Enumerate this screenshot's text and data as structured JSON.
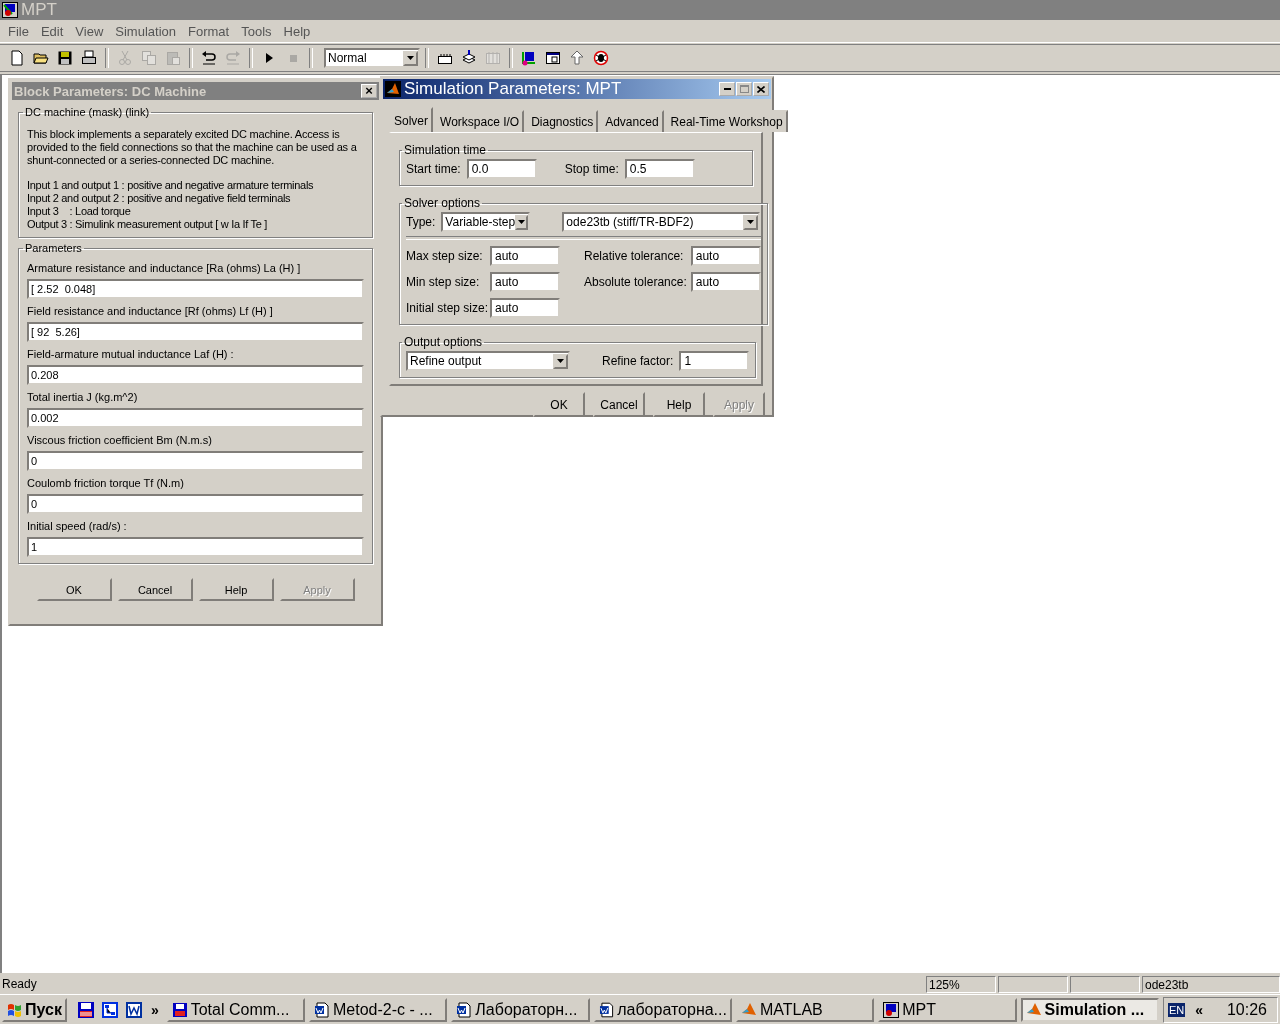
{
  "window": {
    "title": "MPT",
    "active": false
  },
  "menu": [
    "File",
    "Edit",
    "View",
    "Simulation",
    "Format",
    "Tools",
    "Help"
  ],
  "toolbar": {
    "buttons": [
      {
        "disabled": false
      },
      {
        "disabled": false
      },
      {
        "disabled": false
      },
      {
        "disabled": false
      },
      {
        "disabled": true
      },
      {
        "disabled": true
      },
      {
        "disabled": true
      },
      {
        "disabled": false
      },
      {
        "disabled": true
      },
      {
        "disabled": false
      },
      {
        "disabled": true
      },
      {
        "disabled": false
      },
      {
        "disabled": false
      },
      {
        "disabled": true
      },
      {
        "disabled": false
      },
      {
        "disabled": false
      },
      {
        "disabled": false
      },
      {
        "disabled": false
      }
    ],
    "mode": "Normal"
  },
  "block_dialog": {
    "title": "Block Parameters: DC Machine",
    "active": false,
    "close": "×",
    "description": {
      "legend": "DC machine (mask) (link)",
      "text": "This block implements a separately excited DC machine. Access is provided  to the field connections so that the machine can be used as a shunt-connected or a series-connected  DC machine.",
      "lines": [
        "Input 1 and output 1 : positive and negative armature terminals",
        "Input 2 and output 2 : positive and negative field terminals",
        "Input 3    : Load torque",
        "Output 3 : Simulink measurement output [ w Ia If Te ]"
      ]
    },
    "parameters": {
      "legend": "Parameters",
      "fields": [
        {
          "label": "Armature resistance and inductance [Ra (ohms) La (H) ]",
          "value": "[ 2.52  0.048]"
        },
        {
          "label": "Field resistance and inductance [Rf (ohms) Lf (H) ]",
          "value": "[ 92  5.26]"
        },
        {
          "label": "Field-armature mutual inductance Laf (H) :",
          "value": "0.208"
        },
        {
          "label": "Total inertia J (kg.m^2)",
          "value": "0.002"
        },
        {
          "label": "Viscous friction coefficient Bm (N.m.s)",
          "value": "0"
        },
        {
          "label": "Coulomb friction torque Tf (N.m)",
          "value": "0"
        },
        {
          "label": "Initial speed (rad/s) :",
          "value": "1"
        }
      ]
    },
    "buttons": [
      {
        "label": "OK",
        "disabled": false
      },
      {
        "label": "Cancel",
        "disabled": false
      },
      {
        "label": "Help",
        "disabled": false
      },
      {
        "label": "Apply",
        "disabled": true
      }
    ]
  },
  "sim_dialog": {
    "title": "Simulation Parameters: MPT",
    "active": true,
    "tabs": [
      {
        "label": "Solver",
        "selected": true
      },
      {
        "label": "Workspace I/O",
        "selected": false
      },
      {
        "label": "Diagnostics",
        "selected": false
      },
      {
        "label": "Advanced",
        "selected": false
      },
      {
        "label": "Real-Time Workshop",
        "selected": false
      }
    ],
    "simulation_time": {
      "legend": "Simulation time",
      "start_label": "Start time:",
      "start_value": "0.0",
      "stop_label": "Stop time:",
      "stop_value": "0.5"
    },
    "solver_options": {
      "legend": "Solver options",
      "type_label": "Type:",
      "type_value": "Variable-step",
      "solver_value": "ode23tb (stiff/TR-BDF2)",
      "step_fields": [
        {
          "label": "Max step size:",
          "value": "auto"
        },
        {
          "label": "Min step size:",
          "value": "auto"
        },
        {
          "label": "Initial step size:",
          "value": "auto"
        }
      ],
      "tolerance_fields": [
        {
          "label": "Relative tolerance:",
          "value": "auto"
        },
        {
          "label": "Absolute tolerance:",
          "value": "auto"
        }
      ]
    },
    "output_options": {
      "legend": "Output options",
      "mode_value": "Refine output",
      "factor_label": "Refine factor:",
      "factor_value": "1"
    },
    "buttons": [
      {
        "label": "OK",
        "disabled": false
      },
      {
        "label": "Cancel",
        "disabled": false
      },
      {
        "label": "Help",
        "disabled": false
      },
      {
        "label": "Apply",
        "disabled": true
      }
    ]
  },
  "status_bar": {
    "message": "Ready",
    "zoom": "125%",
    "solver": "ode23tb"
  },
  "taskbar": {
    "start": "Пуск",
    "more": "»",
    "tasks": [
      {
        "label": "Total Comm...",
        "selected": false
      },
      {
        "label": "Metod-2-c - ...",
        "selected": false
      },
      {
        "label": "Лабораторн...",
        "selected": false
      },
      {
        "label": "лабораторна...",
        "selected": false
      },
      {
        "label": "MATLAB",
        "selected": false
      },
      {
        "label": "MPT",
        "selected": false
      },
      {
        "label": "Simulation ...",
        "selected": true
      }
    ],
    "language": "EN",
    "tray_toggle": "«",
    "clock": "10:26"
  }
}
